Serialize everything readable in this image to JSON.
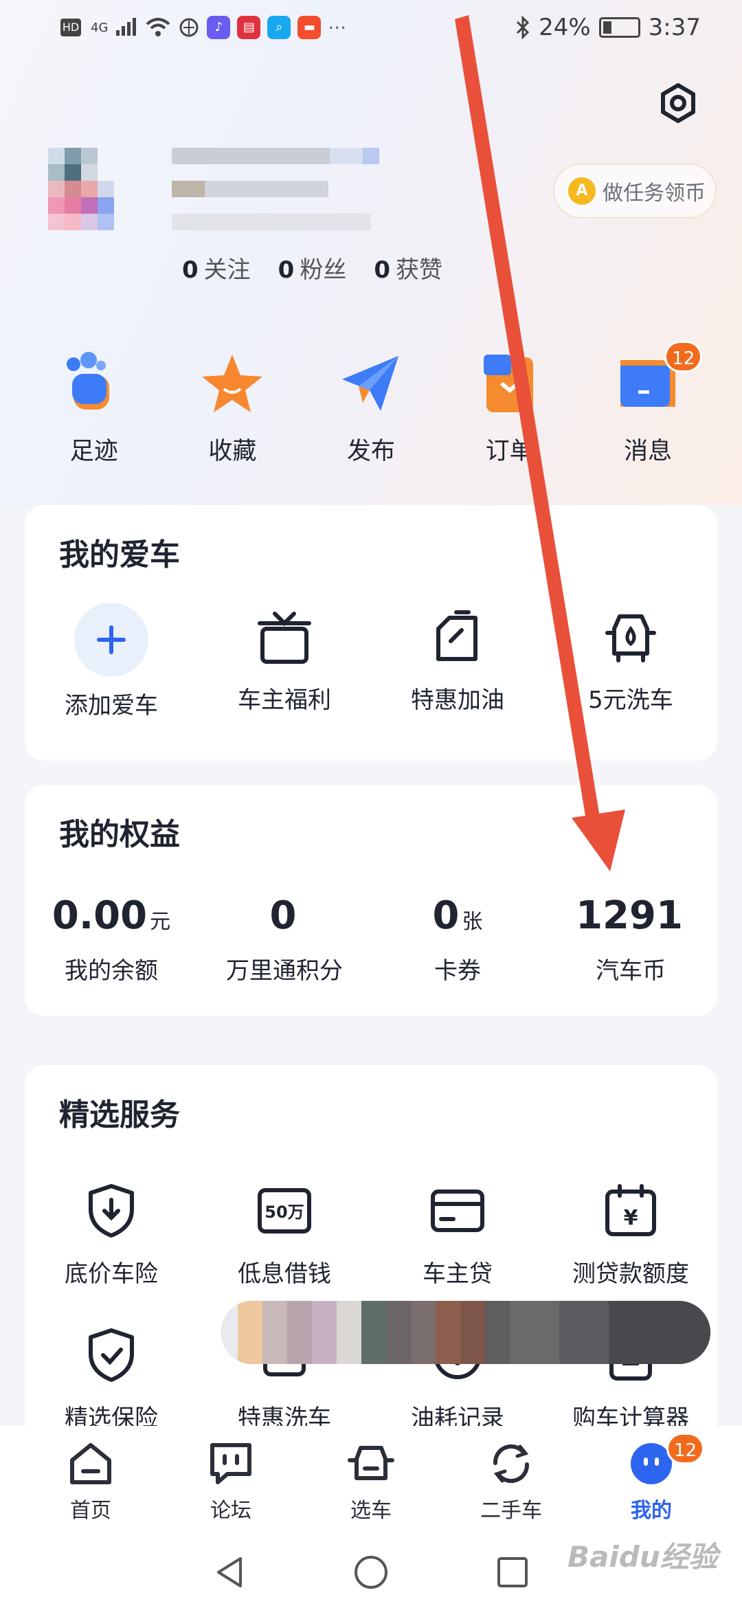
{
  "status_bar": {
    "time": "3:37",
    "battery": "24%",
    "network": "4G",
    "hd": "HD"
  },
  "profile": {
    "follow_count": "0",
    "follow_label": "关注",
    "fans_count": "0",
    "fans_label": "粉丝",
    "likes_count": "0",
    "likes_label": "获赞",
    "task_button": "做任务领币",
    "task_coin_letter": "A"
  },
  "shortcuts": [
    {
      "label": "足迹",
      "icon": "footprint-icon"
    },
    {
      "label": "收藏",
      "icon": "star-icon"
    },
    {
      "label": "发布",
      "icon": "paper-plane-icon"
    },
    {
      "label": "订单",
      "icon": "order-icon"
    },
    {
      "label": "消息",
      "icon": "message-icon",
      "badge": "12"
    }
  ],
  "my_car": {
    "title": "我的爱车",
    "items": [
      {
        "label": "添加爱车",
        "icon": "plus-icon"
      },
      {
        "label": "车主福利",
        "icon": "gift-icon"
      },
      {
        "label": "特惠加油",
        "icon": "fuel-icon"
      },
      {
        "label": "5元洗车",
        "icon": "car-wash-icon"
      }
    ]
  },
  "benefits": {
    "title": "我的权益",
    "items": [
      {
        "value": "0.00",
        "unit": "元",
        "label": "我的余额"
      },
      {
        "value": "0",
        "unit": "",
        "label": "万里通积分"
      },
      {
        "value": "0",
        "unit": "张",
        "label": "卡券"
      },
      {
        "value": "1291",
        "unit": "",
        "label": "汽车币"
      }
    ]
  },
  "services": {
    "title": "精选服务",
    "row1": [
      {
        "label": "底价车险",
        "icon": "shield-download-icon"
      },
      {
        "label": "低息借钱",
        "icon": "loan-50-icon",
        "icon_text": "50万"
      },
      {
        "label": "车主贷",
        "icon": "card-icon"
      },
      {
        "label": "测贷款额度",
        "icon": "calendar-yen-icon",
        "icon_text": "¥"
      }
    ],
    "row2": [
      {
        "label": "精选保险",
        "icon": "shield-check-icon"
      },
      {
        "label": "特惠洗车",
        "icon": "car-wash-icon"
      },
      {
        "label": "油耗记录",
        "icon": "gauge-icon"
      },
      {
        "label": "购车计算器",
        "icon": "calculator-icon"
      }
    ]
  },
  "tabbar": [
    {
      "label": "首页",
      "icon": "home-icon"
    },
    {
      "label": "论坛",
      "icon": "forum-icon"
    },
    {
      "label": "选车",
      "icon": "car-icon"
    },
    {
      "label": "二手车",
      "icon": "refresh-icon"
    },
    {
      "label": "我的",
      "icon": "profile-icon",
      "active": true,
      "badge": "12"
    }
  ],
  "watermark": "Baidu经验",
  "colors": {
    "accent": "#2d64f0",
    "badge": "#f26b1d",
    "arrow": "#e8503a",
    "text": "#1f2430"
  }
}
